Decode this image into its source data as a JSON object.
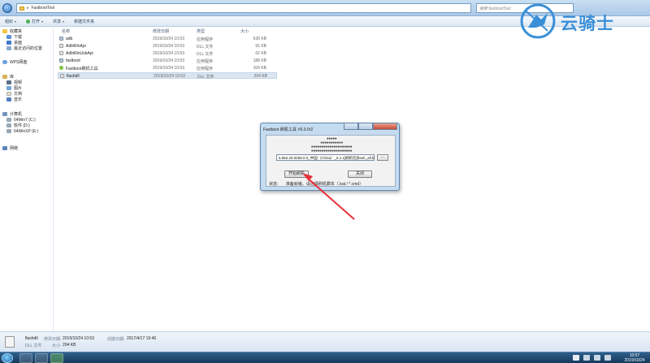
{
  "explorer": {
    "address": [
      "FastbootTool"
    ],
    "search_placeholder": "搜索 fastbootTool",
    "toolbar": {
      "organize": "组织",
      "open": "打开",
      "share": "共享",
      "new_folder": "新建文件夹"
    }
  },
  "navpane": {
    "favorites": {
      "label": "收藏夹",
      "items": [
        "下载",
        "桌面",
        "最近访问的位置"
      ]
    },
    "wps": "WPS网盘",
    "libraries": {
      "label": "库",
      "items": [
        "视频",
        "图片",
        "文档",
        "音乐"
      ]
    },
    "computer": {
      "label": "计算机",
      "items": [
        "64Win7 (C:)",
        "软件 (D:)",
        "64WinXP (E:)"
      ]
    },
    "network": "网络"
  },
  "filelist": {
    "columns": [
      "名称",
      "修改日期",
      "类型",
      "大小"
    ],
    "rows": [
      {
        "name": "adb",
        "date": "2019/10/24 10:53",
        "type": "应用程序",
        "size": "630 KB",
        "icon": "app-icon"
      },
      {
        "name": "AdbWinApi",
        "date": "2019/10/24 10:53",
        "type": "DLL 文件",
        "size": "91 KB",
        "icon": "dll-icon"
      },
      {
        "name": "AdbWinUsbApi",
        "date": "2019/10/24 10:53",
        "type": "DLL 文件",
        "size": "62 KB",
        "icon": "dll-icon"
      },
      {
        "name": "fastboot",
        "date": "2019/10/24 10:53",
        "type": "应用程序",
        "size": "188 KB",
        "icon": "app-icon"
      },
      {
        "name": "Fastboot刷机工具",
        "date": "2019/10/24 10:53",
        "type": "应用程序",
        "size": "104 KB",
        "icon": "tool-icon"
      },
      {
        "name": "flashdll",
        "date": "2019/10/24 10:53",
        "type": "DLL 文件",
        "size": "204 KB",
        "icon": "dll-icon"
      }
    ],
    "selected_index": 5
  },
  "details": {
    "name": "flashdll",
    "type": "DLL 文件",
    "modified_label": "修改日期:",
    "modified": "2019/10/24 10:53",
    "size_label": "大小:",
    "size": "204 KB",
    "created_label": "创建日期:",
    "created": "2017/4/17 19:46"
  },
  "dialog": {
    "title": "Fastboot 刷机工具 V6.0.0r2",
    "dot_rows": [
      "●●●●●",
      "●●●●●●●●●●●",
      "●●●●●●●●●●●●●●●●●●●●",
      "●●●●●●●●●●●●●●●●●●●●"
    ],
    "path": "5.962.20.0258.0.0_中国（China）_5.1.1[刷机包]flash_all.bat",
    "browse": "...",
    "start_button": "开始刷机",
    "close_button": "关闭",
    "status_label": "状态:",
    "status_text": "准备就绪，请选择刷机脚本（.bat / *.cmd）"
  },
  "taskbar": {
    "time": "10:57",
    "date": "2019/10/24"
  },
  "watermark": {
    "text": "云骑士"
  },
  "colors": {
    "arrow": "#e8303a",
    "accent": "#3a8fd8"
  }
}
